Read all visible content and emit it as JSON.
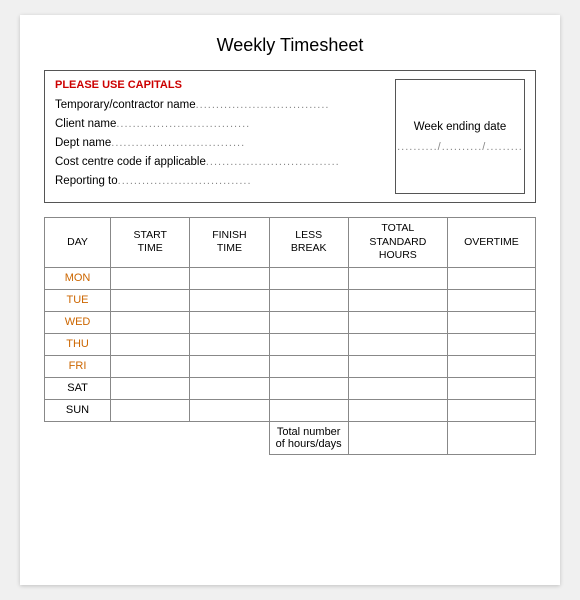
{
  "title": "Weekly Timesheet",
  "infoBox": {
    "header": "PLEASE USE CAPITALS",
    "fields": [
      {
        "label": "Temporary/contractor name",
        "dots": "................................."
      },
      {
        "label": "Client name",
        "dots": "................................."
      },
      {
        "label": "Dept name",
        "dots": "................................."
      },
      {
        "label": "Cost centre code if applicable",
        "dots": "................................."
      },
      {
        "label": "Reporting to",
        "dots": "................................."
      }
    ],
    "weekEnding": {
      "label": "Week ending date",
      "value": "........../........../........."
    }
  },
  "table": {
    "headers": [
      "DAY",
      "START\nTIME",
      "FINISH\nTIME",
      "LESS\nBREAK",
      "TOTAL\nSTANDARD\nHOURS",
      "OVERTIME"
    ],
    "days": [
      {
        "label": "MON",
        "style": "orange"
      },
      {
        "label": "TUE",
        "style": "orange"
      },
      {
        "label": "WED",
        "style": "orange"
      },
      {
        "label": "THU",
        "style": "orange"
      },
      {
        "label": "FRI",
        "style": "orange"
      },
      {
        "label": "SAT",
        "style": "black"
      },
      {
        "label": "SUN",
        "style": "black"
      }
    ],
    "totalLabel": "Total number of hours/days"
  }
}
